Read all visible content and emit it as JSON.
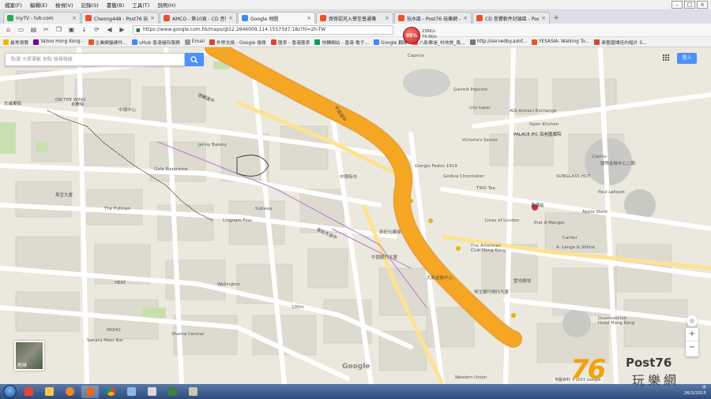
{
  "menu": [
    "檔案(F)",
    "編輯(E)",
    "檢視(V)",
    "記錄(S)",
    "書籤(B)",
    "工具(T)",
    "說明(H)"
  ],
  "tabs": [
    {
      "title": "myTV - tvb.com",
      "color": "#2fa84f"
    },
    {
      "title": "Cheong448 - Post76 玩樂網",
      "color": "#e8542a"
    },
    {
      "title": "AMCO - 第10頁 - CD 音響...",
      "color": "#e8542a"
    },
    {
      "title": "Google 地圖",
      "color": "#4285f4",
      "active": true
    },
    {
      "title": "齊齊認兄入學至普通傳",
      "color": "#e8542a"
    },
    {
      "title": "玩水區 - Post76 玩樂網 - P...",
      "color": "#e8542a"
    },
    {
      "title": "CD 音響軟件討論區 - Post...",
      "color": "#e8542a"
    }
  ],
  "new_tab": "+",
  "url": "https://www.google.com.hk/maps/@22.2846009,114.1557597,18z?hl=zh-TW",
  "cpu_meter": "95%",
  "net_speed": [
    "236K/s",
    "74.5K/s"
  ],
  "bookmarks": [
    {
      "label": "最常瀏覽",
      "color": "#f4b400"
    },
    {
      "label": "Yahoo Hong Kong -",
      "color": "#7b0099"
    },
    {
      "label": "企業網盤硬件...",
      "color": "#e8542a"
    },
    {
      "label": "uHub 香港儲存服務",
      "color": "#4285f4"
    },
    {
      "label": "Email",
      "color": "#999999"
    },
    {
      "label": "外幣兌換 - Google 搜尋",
      "color": "#db4437"
    },
    {
      "label": "匯率 - 香港匯率",
      "color": "#db4437"
    },
    {
      "label": "快轉網站 - 香港 電子...",
      "color": "#0f9d58"
    },
    {
      "label": "Google 翻譯",
      "color": "#4285f4"
    },
    {
      "label": "八影樂迷_村地質_馬...",
      "color": "#e8542a"
    },
    {
      "label": "http://servedby.adof...",
      "color": "#777777"
    },
    {
      "label": "YESASIA: Walking To...",
      "color": "#e8542a"
    },
    {
      "label": "麥藝園場佳的唱片 S...",
      "color": "#db4437"
    }
  ],
  "search": {
    "placeholder": "點選 大眾運輸 地點 搜尋路線"
  },
  "signin_label": "登入",
  "satellite_label": "地球",
  "zoom": {
    "in": "+",
    "out": "−"
  },
  "attribution": "地圖資料 ©2015 Google",
  "google_logo": "Google",
  "watermark": {
    "num": "76",
    "brand": "Post76",
    "sub": "玩樂網"
  },
  "map_labels": [
    {
      "t": "Caprice"
    },
    {
      "t": "Garrett Popcorn"
    },
    {
      "t": "city'super"
    },
    {
      "t": "ADI Armani Exchange"
    },
    {
      "t": "Open Kitchen"
    },
    {
      "t": "PALACE IFC 百老匯戲院"
    },
    {
      "t": "Victoria's Secret"
    },
    {
      "t": "Giorgio Fedon 1919"
    },
    {
      "t": "Godiva Chocolatier"
    },
    {
      "t": "TWG Tea"
    },
    {
      "t": "Lines of London"
    },
    {
      "t": "Pret A Manger"
    },
    {
      "t": "Cartier"
    },
    {
      "t": "A. Lange & Söhne"
    },
    {
      "t": "Apple Store"
    },
    {
      "t": "SUNGLASS HUT"
    },
    {
      "t": "Clarins"
    },
    {
      "t": "Paul Lafayet"
    },
    {
      "t": "The American Club Hong Kong"
    },
    {
      "t": "Doomsdolian Hotel Hong Kong"
    },
    {
      "t": "Western Union"
    },
    {
      "t": "Sahara Mezz Bar"
    },
    {
      "t": "Shama Central"
    },
    {
      "t": "The Putman"
    },
    {
      "t": "Lingnam Fine"
    },
    {
      "t": "Jenny Bakery"
    },
    {
      "t": "Gala Ristorante"
    },
    {
      "t": "Subway"
    },
    {
      "t": "Wellington"
    },
    {
      "t": "100m"
    },
    {
      "t": "文咸東街"
    },
    {
      "t": "永樂街"
    },
    {
      "t": "皇后大道中"
    },
    {
      "t": "德輔道中"
    },
    {
      "t": "干諾道中"
    },
    {
      "t": "中環中心"
    },
    {
      "t": "萬宜大廈"
    },
    {
      "t": "中國銀行大廈"
    },
    {
      "t": "香港站"
    },
    {
      "t": "國際金融中心二期"
    },
    {
      "t": "置地廣場"
    },
    {
      "t": "中環街市"
    },
    {
      "t": "恒生銀行總行大廈"
    },
    {
      "t": "ON THE WING"
    },
    {
      "t": "大新金融中心"
    },
    {
      "t": "新紀元廣場"
    },
    {
      "t": "HEAT"
    },
    {
      "t": "MOHO"
    }
  ],
  "tray": {
    "time": "26/3/2015",
    "lang": "中"
  }
}
